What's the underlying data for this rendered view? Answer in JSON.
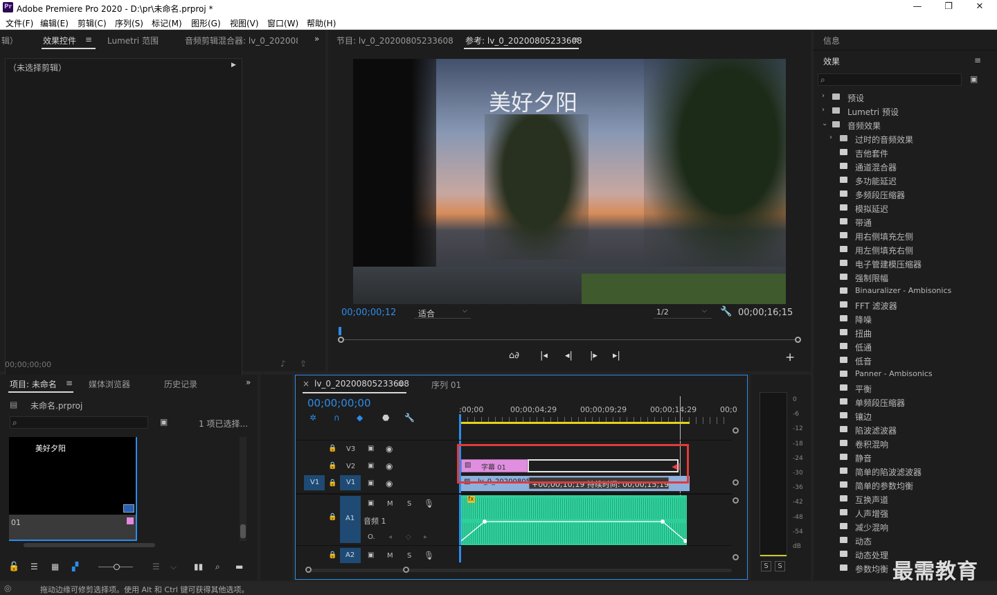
{
  "app": {
    "title": "Adobe Premiere Pro 2020 - D:\\pr\\未命名.prproj *",
    "icon": "Pr",
    "win_min": "—",
    "win_max": "❐",
    "win_close": "✕"
  },
  "menu": [
    "文件(F)",
    "编辑(E)",
    "剪辑(C)",
    "序列(S)",
    "标记(M)",
    "图形(G)",
    "视图(V)",
    "窗口(W)",
    "帮助(H)"
  ],
  "left_panel": {
    "tabs": [
      "辑）",
      "效果控件",
      "Lumetri 范围",
      "音频剪辑混合器: lv_0_202008"
    ],
    "no_clip": "（未选择剪辑）",
    "timecode": "00;00;00;00",
    "more": "»"
  },
  "program": {
    "tabs": [
      "节目: lv_0_20200805233608",
      "参考: lv_0_20200805233608"
    ],
    "overlay_title": "美好夕阳",
    "timecode": "00;00;00;12",
    "fit": "适合",
    "resolution": "1/2",
    "duration": "00;00;16;15",
    "plus": "+"
  },
  "right_panel": {
    "info_tab": "信息",
    "effects_tab": "效果",
    "effects": [
      {
        "label": "预设",
        "type": "folder",
        "level": 0,
        "expanded": false
      },
      {
        "label": "Lumetri 预设",
        "type": "folder",
        "level": 0,
        "expanded": false
      },
      {
        "label": "音频效果",
        "type": "folder",
        "level": 0,
        "expanded": true
      },
      {
        "label": "过时的音频效果",
        "type": "folder",
        "level": 1,
        "expanded": false
      },
      {
        "label": "吉他套件",
        "type": "fx",
        "level": 1
      },
      {
        "label": "通道混合器",
        "type": "fx",
        "level": 1
      },
      {
        "label": "多功能延迟",
        "type": "fx",
        "level": 1
      },
      {
        "label": "多频段压缩器",
        "type": "fx",
        "level": 1
      },
      {
        "label": "模拟延迟",
        "type": "fx",
        "level": 1
      },
      {
        "label": "带通",
        "type": "fx",
        "level": 1
      },
      {
        "label": "用右侧填充左侧",
        "type": "fx",
        "level": 1
      },
      {
        "label": "用左侧填充右侧",
        "type": "fx",
        "level": 1
      },
      {
        "label": "电子管建模压缩器",
        "type": "fx",
        "level": 1
      },
      {
        "label": "强制限幅",
        "type": "fx",
        "level": 1
      },
      {
        "label": "Binauralizer - Ambisonics",
        "type": "fx",
        "level": 1
      },
      {
        "label": "FFT 滤波器",
        "type": "fx",
        "level": 1
      },
      {
        "label": "降噪",
        "type": "fx",
        "level": 1
      },
      {
        "label": "扭曲",
        "type": "fx",
        "level": 1
      },
      {
        "label": "低通",
        "type": "fx",
        "level": 1
      },
      {
        "label": "低音",
        "type": "fx",
        "level": 1
      },
      {
        "label": "Panner - Ambisonics",
        "type": "fx",
        "level": 1
      },
      {
        "label": "平衡",
        "type": "fx",
        "level": 1
      },
      {
        "label": "单频段压缩器",
        "type": "fx",
        "level": 1
      },
      {
        "label": "镶边",
        "type": "fx",
        "level": 1
      },
      {
        "label": "陷波滤波器",
        "type": "fx",
        "level": 1
      },
      {
        "label": "卷积混响",
        "type": "fx",
        "level": 1
      },
      {
        "label": "静音",
        "type": "fx",
        "level": 1
      },
      {
        "label": "简单的陷波滤波器",
        "type": "fx",
        "level": 1
      },
      {
        "label": "简单的参数均衡",
        "type": "fx",
        "level": 1
      },
      {
        "label": "互换声道",
        "type": "fx",
        "level": 1
      },
      {
        "label": "人声增强",
        "type": "fx",
        "level": 1
      },
      {
        "label": "减少混响",
        "type": "fx",
        "level": 1
      },
      {
        "label": "动态",
        "type": "fx",
        "level": 1
      },
      {
        "label": "动态处理",
        "type": "fx",
        "level": 1
      },
      {
        "label": "参数均衡",
        "type": "fx",
        "level": 1
      }
    ]
  },
  "project": {
    "tabs": [
      "项目: 未命名",
      "媒体浏览器",
      "历史记录"
    ],
    "file": "未命名.prproj",
    "selected": "1 项已选择...",
    "thumb_title": "美好夕阳",
    "thumb_label": "01",
    "more": "»"
  },
  "timeline": {
    "tabs": [
      "lv_0_20200805233608",
      "序列 01"
    ],
    "close": "×",
    "timecode": "00;00;00;00",
    "ruler": [
      ";00;00",
      "00;00;04;29",
      "00;00;09;29",
      "00;00;14;29",
      "00;0"
    ],
    "tracks": {
      "v3": "V3",
      "v2": "V2",
      "v1": "V1",
      "a1": "A1",
      "a2": "A2",
      "audio1_name": "音频 1",
      "m": "M",
      "s": "S"
    },
    "clip_title": "字幕 01",
    "clip_video": "lv_0_20200805233608.mp4",
    "tooltip": "+00;00;10;19 持续时间: 00;00;15;19",
    "fx": "fx"
  },
  "meter": {
    "scale": [
      "0",
      "-6",
      "-12",
      "-18",
      "-24",
      "-30",
      "-36",
      "-42",
      "-48",
      "-54",
      "dB"
    ],
    "solo": "S"
  },
  "status": "拖动边缘可修剪选择项。使用 Alt 和 Ctrl 键可获得其他选项。",
  "watermark": "最需教育"
}
